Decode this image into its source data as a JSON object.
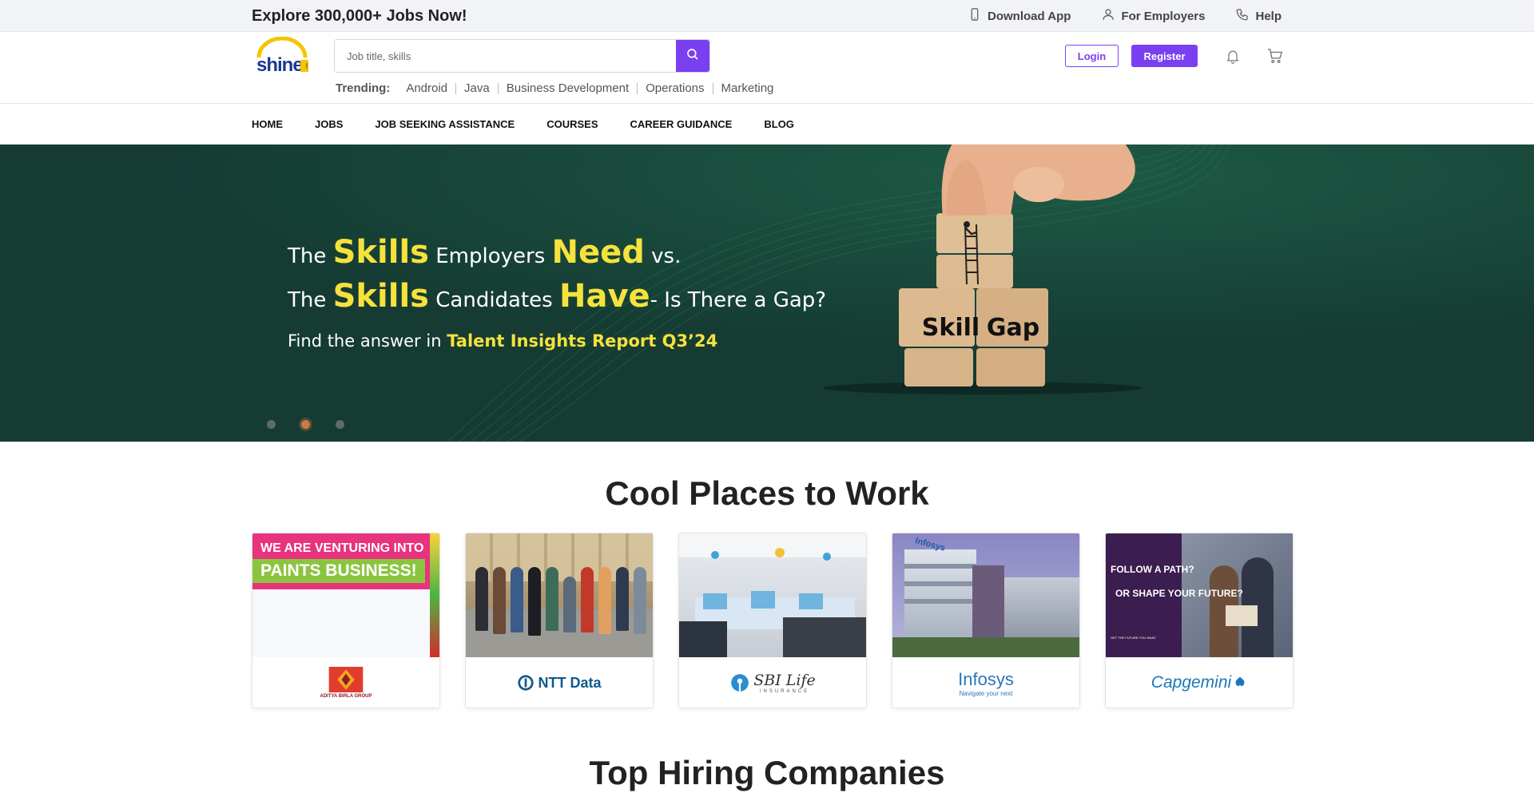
{
  "topbar": {
    "promo": "Explore 300,000+ Jobs Now!",
    "links": [
      {
        "label": "Download App",
        "icon": "phone-icon"
      },
      {
        "label": "For Employers",
        "icon": "user-icon"
      },
      {
        "label": "Help",
        "icon": "headset-phone-icon"
      }
    ]
  },
  "header": {
    "logo_text": "shine",
    "logo_suffix": ".com",
    "search_placeholder": "Job title, skills",
    "trending_label": "Trending:",
    "trending": [
      "Android",
      "Java",
      "Business Development",
      "Operations",
      "Marketing"
    ],
    "login": "Login",
    "register": "Register"
  },
  "nav": [
    "HOME",
    "JOBS",
    "JOB SEEKING ASSISTANCE",
    "COURSES",
    "CAREER GUIDANCE",
    "BLOG"
  ],
  "banner": {
    "line1_a": "The ",
    "line1_b": "Skills",
    "line1_c": " Employers ",
    "line1_d": "Need",
    "line1_e": " vs.",
    "line2_a": "The ",
    "line2_b": "Skills",
    "line2_c": " Candidates ",
    "line2_d": "Have",
    "line2_e": "- Is There a Gap?",
    "line3_a": "Find the answer in ",
    "line3_b": "Talent Insights Report Q3’24",
    "block_left": "Skill",
    "block_right": "Gap",
    "slides": 3,
    "active_slide": 2
  },
  "cool_places": {
    "title": "Cool Places to Work",
    "cards": [
      {
        "company": "ADITYA BIRLA GROUP",
        "image_text_1": "WE ARE VENTURING INTO",
        "image_text_2": "PAINTS BUSINESS!"
      },
      {
        "company": "NTT Data"
      },
      {
        "company": "SBI Life",
        "sub": "INSURANCE"
      },
      {
        "company": "Infosys",
        "sub": "Navigate your next",
        "image_text_1": "Infosys"
      },
      {
        "company": "Capgemini",
        "image_text_1": "FOLLOW A PATH?",
        "image_text_2": "OR SHAPE YOUR FUTURE?",
        "image_text_3": "GET THE FUTURE YOU WANT"
      }
    ]
  },
  "top_hiring": {
    "title": "Top Hiring Companies"
  },
  "colors": {
    "accent": "#7b3ff2",
    "banner_bg": "#153b33",
    "banner_highlight": "#f5e23b"
  }
}
